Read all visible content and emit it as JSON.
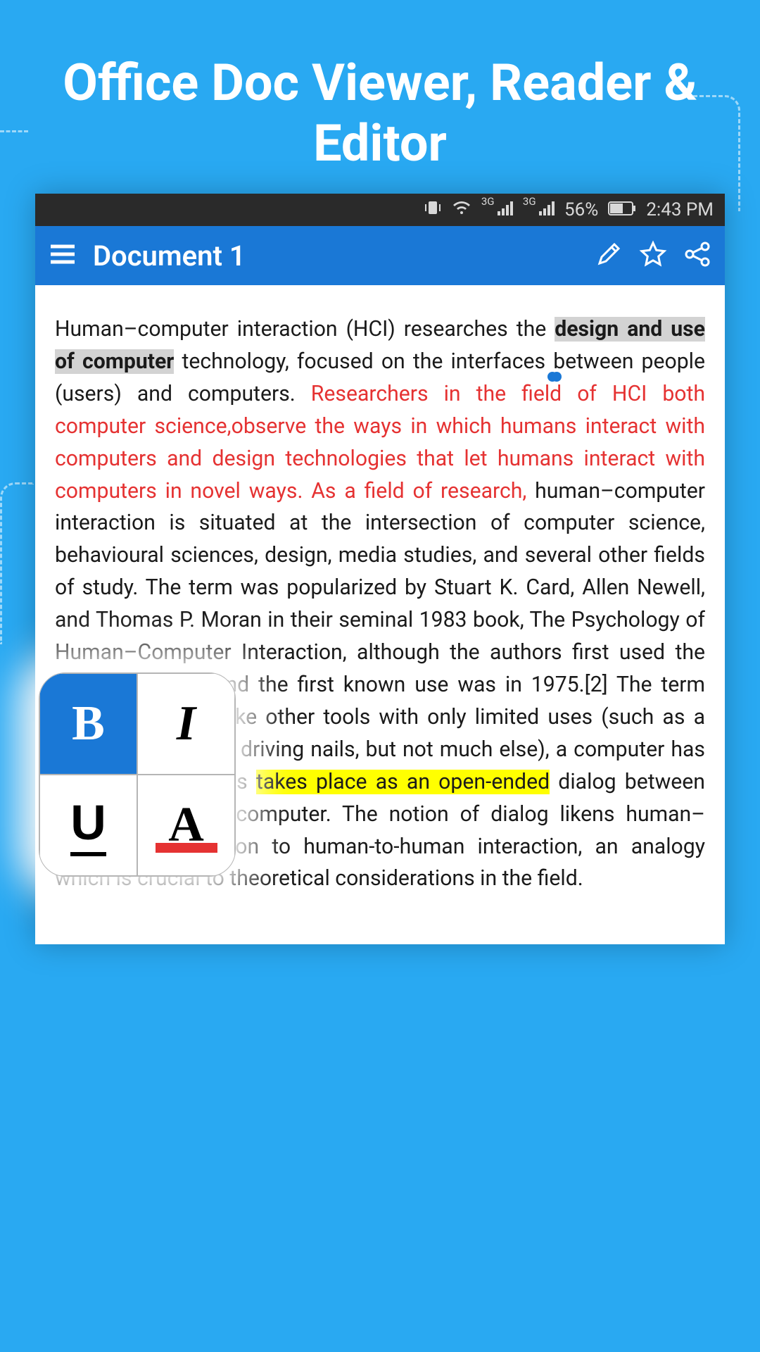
{
  "promo": {
    "title": "Office Doc Viewer, Reader & Editor"
  },
  "statusbar": {
    "network_badge": "3G",
    "battery_pct": "56%",
    "time": "2:43 PM"
  },
  "appbar": {
    "title": "Document 1"
  },
  "doc": {
    "p1a": "Human–computer interaction (HCI) researches the ",
    "sel": "design and use of computer",
    "p1b": " technology, focused on the interfaces between people (users) and computers. ",
    "red": "Researchers in the field of HCI both computer science,observe the ways in which humans interact with computers and design technologies that let humans interact with computers in novel ways. As a field of research,",
    "p2a": " human–computer interaction is situated at the intersection of computer science, behavioural sciences, design, media studies, and several other fields of study. The term was popularized by Stuart K. Card, Allen Newell, and Thomas P. Moran in their seminal 1983 book, The Psychology of Human–Computer Interaction, although the authors first used the term in 1980[1] and the first known use was in 1975.[2] The term connotes that, unlike other tools with only limited uses (such as a hammer, useful for driving nails, but not much else), a computer has many uses and this ",
    "hi": "takes place as an open-ended",
    "p2b": " dialog between the user and the computer. The notion of dialog likens human–computer interaction to human-to-human interaction, an analogy which is crucial to theoretical considerations in the field."
  },
  "palette": {
    "bold": "B",
    "italic": "I",
    "underline": "U",
    "color": "A"
  }
}
